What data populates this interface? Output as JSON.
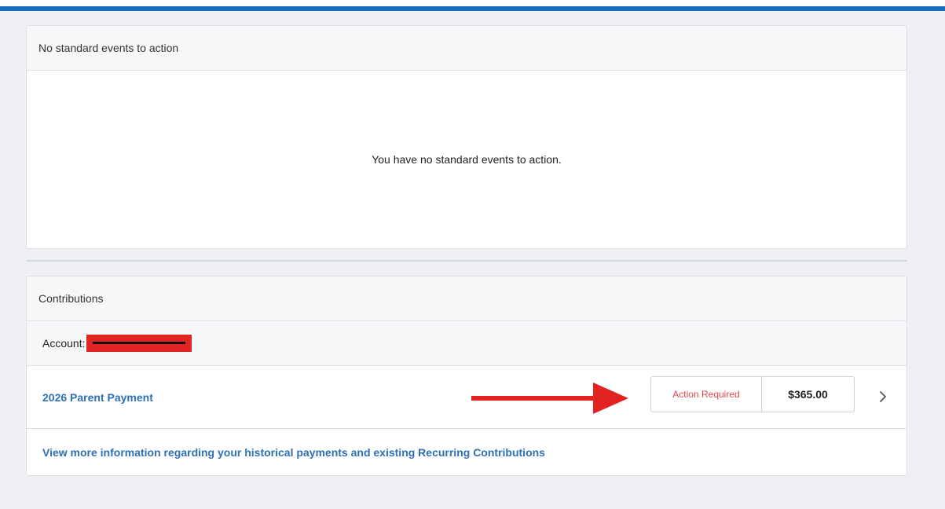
{
  "events_card": {
    "header": "No standard events to action",
    "empty_message": "You have no standard events to action."
  },
  "contributions_card": {
    "header": "Contributions",
    "account_label": "Account:",
    "payment": {
      "title": "2026 Parent Payment",
      "status": "Action Required",
      "amount": "$365.00"
    },
    "history_link": "View more information regarding your historical payments and existing Recurring Contributions"
  },
  "icons": {
    "chevron": "chevron-right-icon",
    "arrow": "red-arrow-annotation"
  },
  "colors": {
    "accent": "#1a6fc4",
    "link": "#2f6fb6",
    "status_text": "#e04848",
    "annotation": "#e32222"
  }
}
